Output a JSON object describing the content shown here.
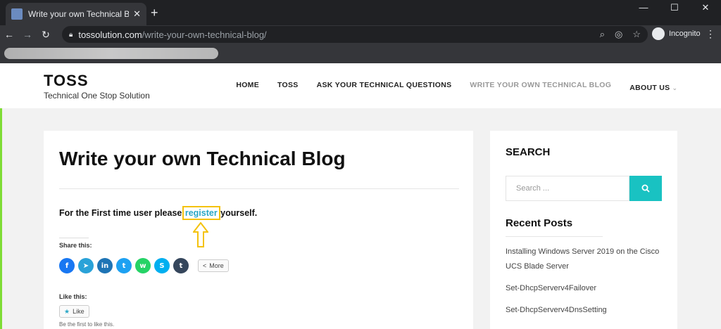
{
  "browser": {
    "tab_title": "Write your own Technical Blog - T",
    "url_host": "tossolution.com",
    "url_path": "/write-your-own-technical-blog/",
    "profile_label": "Incognito"
  },
  "site": {
    "title": "TOSS",
    "tagline": "Technical One Stop Solution",
    "nav": [
      {
        "label": "HOME"
      },
      {
        "label": "TOSS"
      },
      {
        "label": "ASK YOUR TECHNICAL QUESTIONS"
      },
      {
        "label": "WRITE YOUR OWN TECHNICAL BLOG"
      },
      {
        "label": "ABOUT US"
      }
    ]
  },
  "article": {
    "title": "Write your own Technical Blog",
    "register_prefix": "For the First time user please ",
    "register_link": "register",
    "register_suffix": " yourself.",
    "share_label": "Share this:",
    "share_icons": [
      {
        "name": "facebook-icon",
        "glyph": "f",
        "color": "#1877f2"
      },
      {
        "name": "telegram-icon",
        "glyph": "➤",
        "color": "#2aa2d8"
      },
      {
        "name": "linkedin-icon",
        "glyph": "in",
        "color": "#1e74b5"
      },
      {
        "name": "twitter-icon",
        "glyph": "t",
        "color": "#1da1f2"
      },
      {
        "name": "whatsapp-icon",
        "glyph": "w",
        "color": "#25d366"
      },
      {
        "name": "skype-icon",
        "glyph": "S",
        "color": "#00aff0"
      },
      {
        "name": "tumblr-icon",
        "glyph": "t",
        "color": "#35465c"
      }
    ],
    "more_label": "More",
    "like_label": "Like this:",
    "like_button": "Like",
    "like_first": "Be the first to like this."
  },
  "sidebar": {
    "search_title": "SEARCH",
    "search_placeholder": "Search ...",
    "recent_title": "Recent Posts",
    "posts": [
      {
        "label": "Installing Windows Server 2019 on the Cisco UCS Blade Server"
      },
      {
        "label": "Set-DhcpServerv4Failover"
      },
      {
        "label": "Set-DhcpServerv4DnsSetting"
      }
    ]
  }
}
